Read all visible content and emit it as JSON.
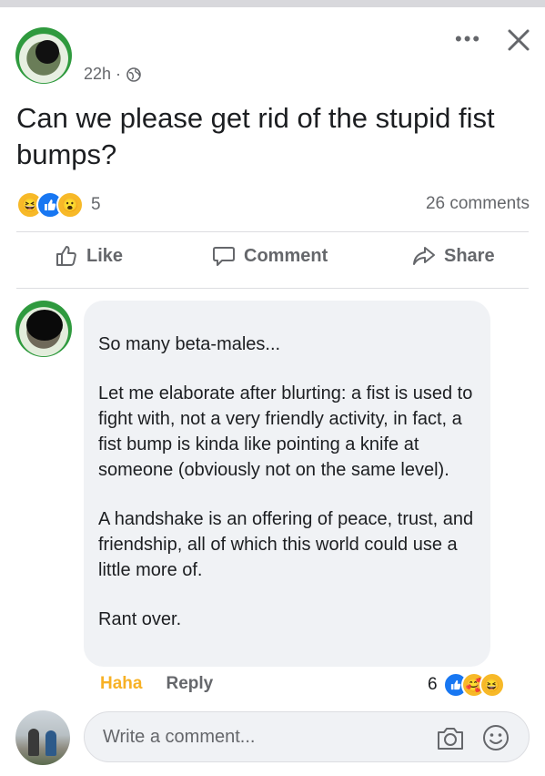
{
  "post": {
    "time": "22h ·",
    "text": "Can we please get rid of the stupid fist bumps?",
    "reaction_count": "5",
    "comments_count": "26 comments",
    "reaction_icons": [
      "haha-icon",
      "like-icon",
      "wow-icon"
    ]
  },
  "header": {
    "more_label": "•••",
    "close_icon": "close-icon"
  },
  "actions": {
    "like": "Like",
    "comment": "Comment",
    "share": "Share"
  },
  "comment": {
    "paragraphs": [
      "So many beta-males...",
      "Let me elaborate after blurting: a fist is used to fight with, not a very friendly activity, in fact, a fist bump is kinda like pointing a knife at someone (obviously not on the same level).",
      "A handshake is an offering of peace, trust, and friendship, all of which this world could use a little more of.",
      "Rant over."
    ],
    "haha_label": "Haha",
    "reply_label": "Reply",
    "reaction_count": "6",
    "reaction_icons": [
      "like-icon",
      "love-icon",
      "haha-icon"
    ]
  },
  "composer": {
    "placeholder": "Write a comment...",
    "camera_icon": "camera-icon",
    "emoji_icon": "emoji-icon"
  },
  "colors": {
    "like_blue": "#1877f2",
    "haha_yellow": "#f7b125",
    "muted_text": "#65676b",
    "bubble_bg": "#f0f2f5"
  }
}
